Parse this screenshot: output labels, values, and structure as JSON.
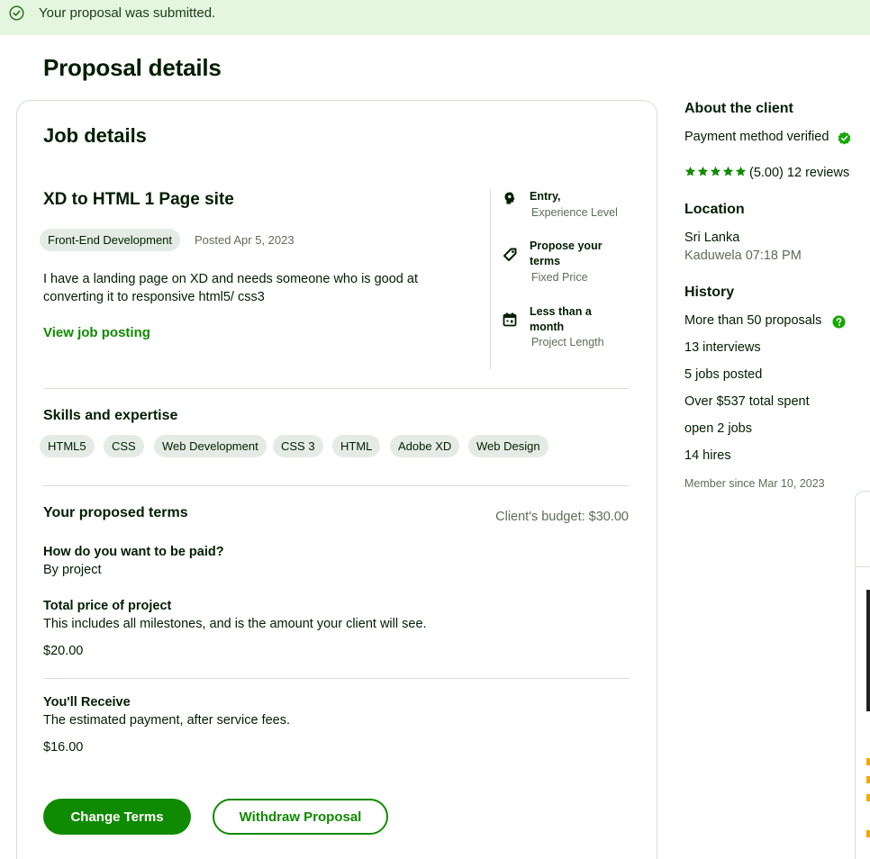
{
  "banner": {
    "message": "Your proposal was submitted."
  },
  "page": {
    "title": "Proposal details"
  },
  "job": {
    "section_title": "Job details",
    "title": "XD to HTML 1 Page site",
    "category": "Front-End Development",
    "posted": "Posted Apr 5, 2023",
    "description": "I have a landing page on XD and needs someone who is good at converting it to responsive html5/ css3",
    "view_link": "View job posting",
    "attributes": [
      {
        "icon": "brain-icon",
        "main": "Entry,",
        "sub": "Experience Level"
      },
      {
        "icon": "price-tag-icon",
        "main": "Propose your terms",
        "sub": "Fixed Price"
      },
      {
        "icon": "calendar-icon",
        "main": "Less than a month",
        "sub": "Project Length"
      }
    ]
  },
  "skills": {
    "title": "Skills and expertise",
    "items": [
      "HTML5",
      "CSS",
      "Web Development",
      "CSS 3",
      "HTML",
      "Adobe XD",
      "Web Design"
    ]
  },
  "terms": {
    "title": "Your proposed terms",
    "budget": "Client's budget: $30.00",
    "paid_question": "How do you want to be paid?",
    "paid_answer": "By project",
    "total_label": "Total price of project",
    "total_desc": "This includes all milestones, and is the amount your client will see.",
    "total_value": "$20.00",
    "receive_label": "You'll Receive",
    "receive_desc": "The estimated payment, after service fees.",
    "receive_value": "$16.00"
  },
  "buttons": {
    "change": "Change Terms",
    "withdraw": "Withdraw Proposal"
  },
  "client": {
    "title": "About the client",
    "payment": "Payment method verified",
    "rating": 5,
    "rating_text": "(5.00) 12 reviews",
    "location_title": "Location",
    "country": "Sri Lanka",
    "city_time": "Kaduwela 07:18 PM",
    "history_title": "History",
    "proposals": "More than 50 proposals",
    "interviews": "13 interviews",
    "jobs_posted": "5 jobs posted",
    "spent": "Over $537 total spent",
    "open_jobs": "open 2 jobs",
    "hires": "14 hires",
    "member_since": "Member since Mar 10, 2023"
  },
  "colors": {
    "brand_green": "#108a00",
    "banner_bg": "#e4f5e0",
    "tag_bg": "#e4ebe4",
    "muted": "#5e6d55"
  }
}
